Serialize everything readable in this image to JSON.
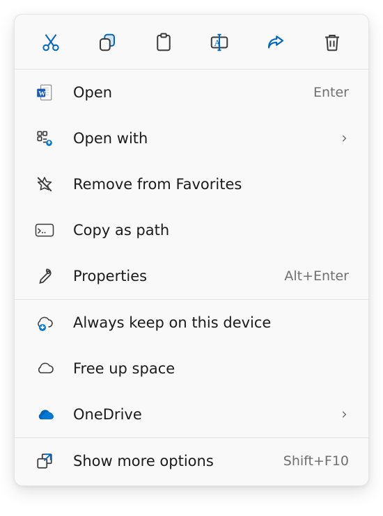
{
  "toolbar": {
    "cut": "Cut",
    "copy": "Copy",
    "paste": "Paste",
    "rename": "Rename",
    "share": "Share",
    "delete": "Delete"
  },
  "menu": {
    "open": {
      "label": "Open",
      "shortcut": "Enter"
    },
    "open_with": {
      "label": "Open with"
    },
    "remove_favorites": {
      "label": "Remove from Favorites"
    },
    "copy_path": {
      "label": "Copy as path"
    },
    "properties": {
      "label": "Properties",
      "shortcut": "Alt+Enter"
    },
    "always_keep": {
      "label": "Always keep on this device"
    },
    "free_up": {
      "label": "Free up space"
    },
    "onedrive": {
      "label": "OneDrive"
    },
    "more_options": {
      "label": "Show more options",
      "shortcut": "Shift+F10"
    }
  },
  "colors": {
    "accent_blue": "#0067c0",
    "icon_gray": "#3a3a3a"
  }
}
